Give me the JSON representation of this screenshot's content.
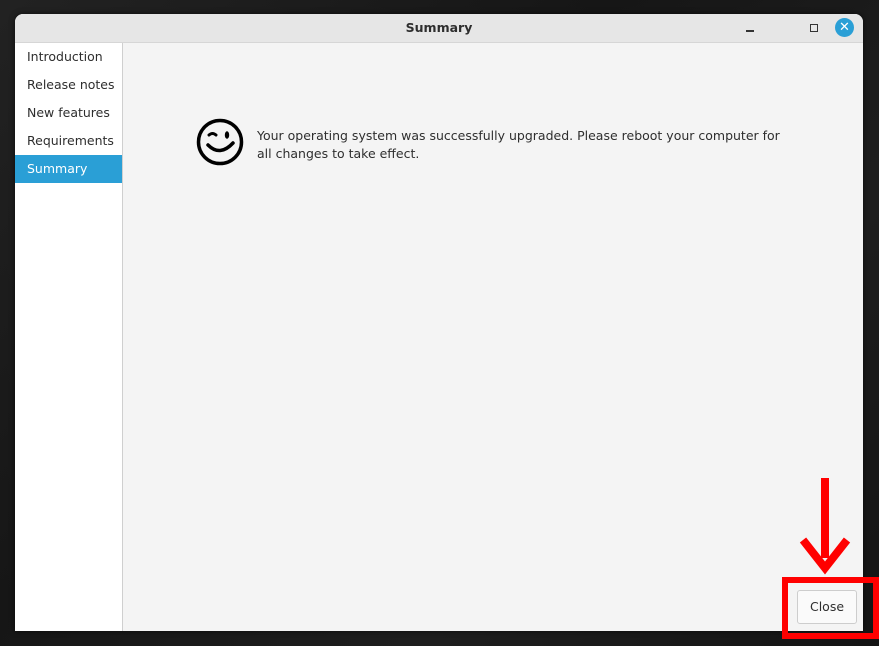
{
  "window": {
    "title": "Summary",
    "controls": {
      "minimize": "minimize",
      "maximize": "maximize",
      "close_glyph": "✕"
    }
  },
  "sidebar": {
    "items": [
      {
        "label": "Introduction",
        "active": false
      },
      {
        "label": "Release notes",
        "active": false
      },
      {
        "label": "New features",
        "active": false
      },
      {
        "label": "Requirements",
        "active": false
      },
      {
        "label": "Summary",
        "active": true
      }
    ]
  },
  "main": {
    "icon": "winking-face-icon",
    "message": "Your operating system was successfully upgraded. Please reboot your computer for all changes to take effect."
  },
  "footer": {
    "close_label": "Close"
  },
  "annotation": {
    "color": "#ff0000",
    "target": "close-button"
  },
  "colors": {
    "accent": "#2a9fd6"
  }
}
